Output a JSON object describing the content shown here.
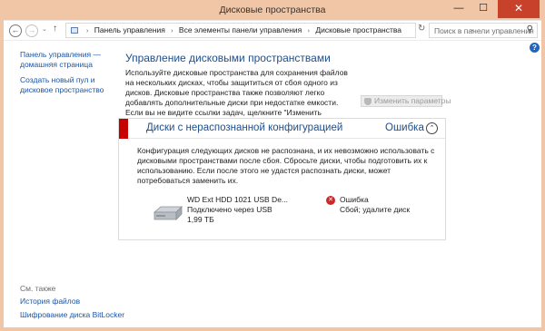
{
  "window": {
    "title": "Дисковые пространства",
    "min_glyph": "—",
    "max_glyph": "☐",
    "close_glyph": "✕"
  },
  "navbar": {
    "back_glyph": "←",
    "forward_glyph": "→",
    "recent_glyph": "⌄",
    "up_glyph": "↑",
    "breadcrumb": [
      "Панель управления",
      "Все элементы панели управления",
      "Дисковые пространства"
    ],
    "separator": "›",
    "dropdown_glyph": "⌄",
    "refresh_glyph": "↻",
    "search_placeholder": "Поиск в панели управления",
    "search_glyph": "⚲"
  },
  "help": {
    "glyph": "?"
  },
  "left_pane": {
    "home_link": "Панель управления — домашняя страница",
    "create_link": "Создать новый пул и дисковое пространство",
    "see_also": "См. также",
    "history_link": "История файлов",
    "bitlocker_link": "Шифрование диска BitLocker"
  },
  "main": {
    "heading": "Управление дисковыми пространствами",
    "description": "Используйте дисковые пространства для сохранения файлов на нескольких дисках, чтобы защититься от сбоя одного из дисков. Дисковые пространства также позволяют легко добавлять дополнительные диски при недостатке емкости. Если вы не видите ссылки задач, щелкните \"Изменить параметры\".",
    "change_button": "Изменить параметры"
  },
  "panel": {
    "title": "Диски с нераспознанной конфигурацией",
    "status": "Ошибка",
    "collapse_glyph": "⌃",
    "message": "Конфигурация следующих дисков не распознана, и их невозможно использовать с дисковыми пространствами после сбоя. Сбросьте диски, чтобы подготовить их к использованию. Если после этого не удастся распознать диски, может потребоваться заменить их.",
    "drive": {
      "name": "WD Ext HDD 1021 USB De...",
      "connection": "Подключено через USB",
      "size": "1,99 ТБ",
      "error_glyph": "✕",
      "error_label": "Ошибка",
      "error_detail": "Сбой; удалите диск"
    }
  },
  "colors": {
    "titlebar": "#f0c6a6",
    "close_button": "#c7412b",
    "link": "#1a55a8",
    "heading": "#1e4e8c",
    "error_bar": "#c60000"
  }
}
